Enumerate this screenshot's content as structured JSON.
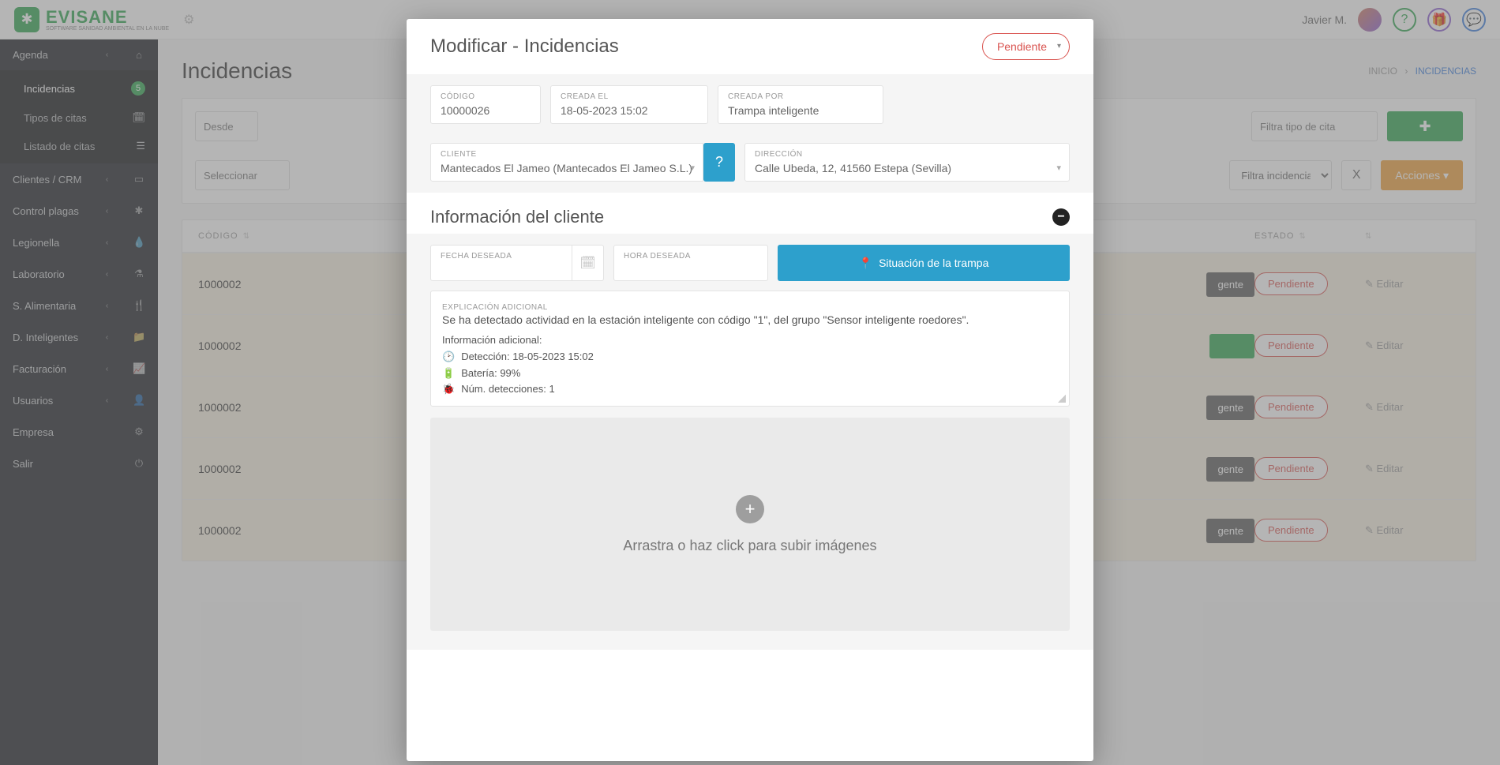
{
  "brand": {
    "name": "EVISANE",
    "tagline": "SOFTWARE SANIDAD AMBIENTAL EN LA NUBE"
  },
  "user": {
    "display_name": "Javier M."
  },
  "sidebar": {
    "agenda_label": "Agenda",
    "incidencias": {
      "label": "Incidencias",
      "badge": "5"
    },
    "tipos_citas": "Tipos de citas",
    "listado_citas": "Listado de citas",
    "clientes": "Clientes / CRM",
    "control_plagas": "Control plagas",
    "legionella": "Legionella",
    "laboratorio": "Laboratorio",
    "s_alimentaria": "S. Alimentaria",
    "d_inteligentes": "D. Inteligentes",
    "facturacion": "Facturación",
    "usuarios": "Usuarios",
    "empresa": "Empresa",
    "salir": "Salir"
  },
  "page": {
    "title": "Incidencias",
    "crumb_home": "INICIO",
    "crumb_current": "INCIDENCIAS"
  },
  "filters": {
    "desde": "Desde",
    "selecciona": "Seleccionar",
    "filtra_cita": "Filtra tipo de cita",
    "filtra_inc": "Filtra incidencias",
    "acciones": "Acciones"
  },
  "table": {
    "col_codigo": "CÓDIGO",
    "col_estado": "ESTADO",
    "rows": [
      {
        "codigo": "1000002",
        "estado": "Pendiente",
        "tag": "gente",
        "tagcolor": "gray",
        "editar": "Editar"
      },
      {
        "codigo": "1000002",
        "estado": "Pendiente",
        "tag": "",
        "tagcolor": "green",
        "editar": "Editar"
      },
      {
        "codigo": "1000002",
        "estado": "Pendiente",
        "tag": "gente",
        "tagcolor": "gray",
        "editar": "Editar"
      },
      {
        "codigo": "1000002",
        "estado": "Pendiente",
        "tag": "gente",
        "tagcolor": "gray",
        "editar": "Editar"
      },
      {
        "codigo": "1000002",
        "estado": "Pendiente",
        "tag": "gente",
        "tagcolor": "gray",
        "editar": "Editar"
      }
    ]
  },
  "modal": {
    "title": "Modificar - Incidencias",
    "status": "Pendiente",
    "codigo_label": "CÓDIGO",
    "codigo_value": "10000026",
    "creada_el_label": "CREADA EL",
    "creada_el_value": "18-05-2023 15:02",
    "creada_por_label": "CREADA POR",
    "creada_por_value": "Trampa inteligente",
    "cliente_label": "CLIENTE",
    "cliente_value": "Mantecados El Jameo (Mantecados El Jameo S.L.)",
    "direccion_label": "DIRECCIÓN",
    "direccion_value": "Calle Ubeda, 12, 41560 Estepa (Sevilla)",
    "info_cliente_title": "Información del cliente",
    "fecha_deseada_label": "FECHA DESEADA",
    "hora_deseada_label": "HORA DESEADA",
    "situacion_btn": "Situación de la trampa",
    "explicacion_label": "EXPLICACIÓN ADICIONAL",
    "explicacion_text": "Se ha detectado actividad en la estación inteligente con código \"1\", del grupo \"Sensor inteligente roedores\".",
    "info_adicional_title": "Información adicional:",
    "deteccion_line": "Detección: 18-05-2023 15:02",
    "bateria_line": "Batería: 99%",
    "num_det_line": "Núm. detecciones: 1",
    "dropzone_text": "Arrastra o haz click para subir imágenes"
  }
}
